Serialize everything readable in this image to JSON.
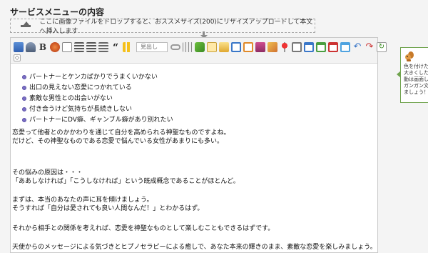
{
  "section_title": "サービスメニューの内容",
  "dropzone_text": "ここに画像ファイルをドロップすると、おススメサイズ(200)にリサイズアップロードして本文へ挿入します",
  "toolbar": {
    "bold_label": "B",
    "quote_label": "“",
    "heading_select_value": "見出し",
    "expand_label": "◇"
  },
  "content": {
    "bullets": [
      "パートナーとケンカばかりでうまくいかない",
      "出口の見えない恋愛につかれている",
      "素敵な男性との出会いがない",
      "付き合うけど気持ちが長続きしない",
      "パートナーにDV癖、ギャンブル癖があり別れたい"
    ],
    "para1": [
      "恋愛って他者とのかかわりを通じて自分を高められる神聖なものですよね。",
      "だけど、その神聖なものである恋愛で悩んでいる女性があまりにも多い。"
    ],
    "para2": [
      "その悩みの原因は・・・",
      "「ああしなければ」「こうしなければ」という既成概念であることがほとんど。"
    ],
    "para3": [
      "まずは、本当のあなたの声に耳を傾けましょう。",
      "そうすれば「自分は愛されても良い人間なんだ！」とわかるはず。"
    ],
    "para4": "それから相手との関係を考えれば、恋愛を神聖なものとして楽しむこともできるはずです。",
    "para5": "天使からのメッセージによる気づきとヒプノセラピーによる癒しで、あなた本来の輝きのまま、素敵な恋愛を楽しみましょう。"
  },
  "side_tip": {
    "text": "色を付けた\n大きくした\n動は画面し\nガンガン文\nましょう！"
  },
  "colors": {
    "bullet": "#7b6fc4",
    "tip_border": "#6fa34d"
  }
}
